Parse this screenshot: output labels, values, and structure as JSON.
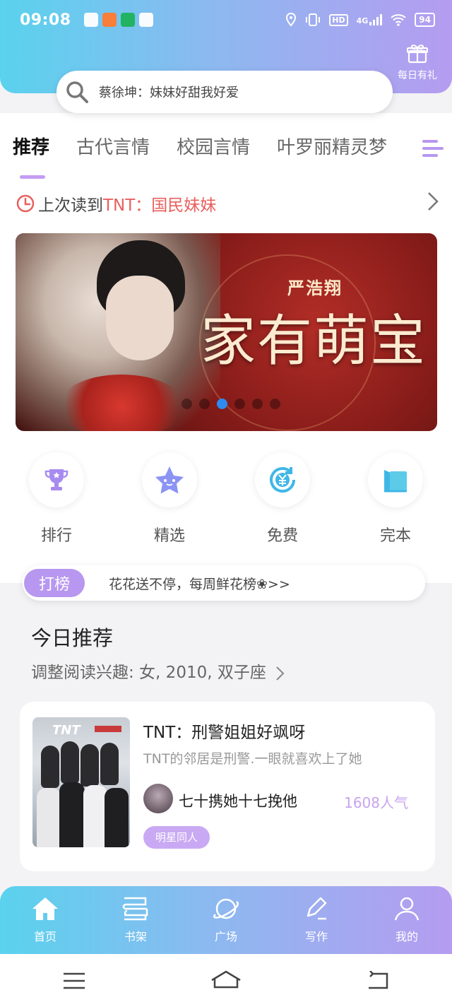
{
  "status_bar": {
    "time": "09:08",
    "network": "4G",
    "hd": "HD",
    "battery": "94"
  },
  "header": {
    "gift_label": "每日有礼"
  },
  "search": {
    "placeholder": "蔡徐坤：妹妹好甜我好爱"
  },
  "tabs": [
    {
      "label": "推荐",
      "active": true
    },
    {
      "label": "古代言情",
      "active": false
    },
    {
      "label": "校园言情",
      "active": false
    },
    {
      "label": "叶罗丽精灵梦",
      "active": false
    }
  ],
  "last_read": {
    "prefix": "上次读到",
    "book": "TNT：国民妹妹"
  },
  "banner": {
    "subtitle": "严浩翔",
    "title": "家有萌宝",
    "page_count": 6,
    "active_index": 2
  },
  "quick_links": [
    {
      "label": "排行",
      "icon": "trophy-icon"
    },
    {
      "label": "精选",
      "icon": "star-icon"
    },
    {
      "label": "免费",
      "icon": "yen-icon"
    },
    {
      "label": "完本",
      "icon": "book-icon"
    }
  ],
  "promo": {
    "tag": "打榜",
    "text": "花花送不停，每周鲜花榜❀>>"
  },
  "section": {
    "title": "今日推荐",
    "interest": "调整阅读兴趣: 女, 2010, 双子座"
  },
  "book": {
    "title": "TNT：刑警姐姐好飒呀",
    "description": "TNT的邻居是刑警.一眼就喜欢上了她",
    "author": "七十携她十七挽他",
    "popularity": "1608人气",
    "tag": "明星同人",
    "cover_logo": "TNT"
  },
  "tabbar": [
    {
      "label": "首页",
      "icon": "home-icon"
    },
    {
      "label": "书架",
      "icon": "bookshelf-icon"
    },
    {
      "label": "广场",
      "icon": "planet-icon"
    },
    {
      "label": "写作",
      "icon": "pen-icon"
    },
    {
      "label": "我的",
      "icon": "profile-icon"
    }
  ],
  "colors": {
    "accent": "#b797f0",
    "header_gradient_start": "#5ad2ee",
    "header_gradient_end": "#b59cf0",
    "highlight_red": "#e8605e",
    "active_dot": "#2e8bf0"
  }
}
